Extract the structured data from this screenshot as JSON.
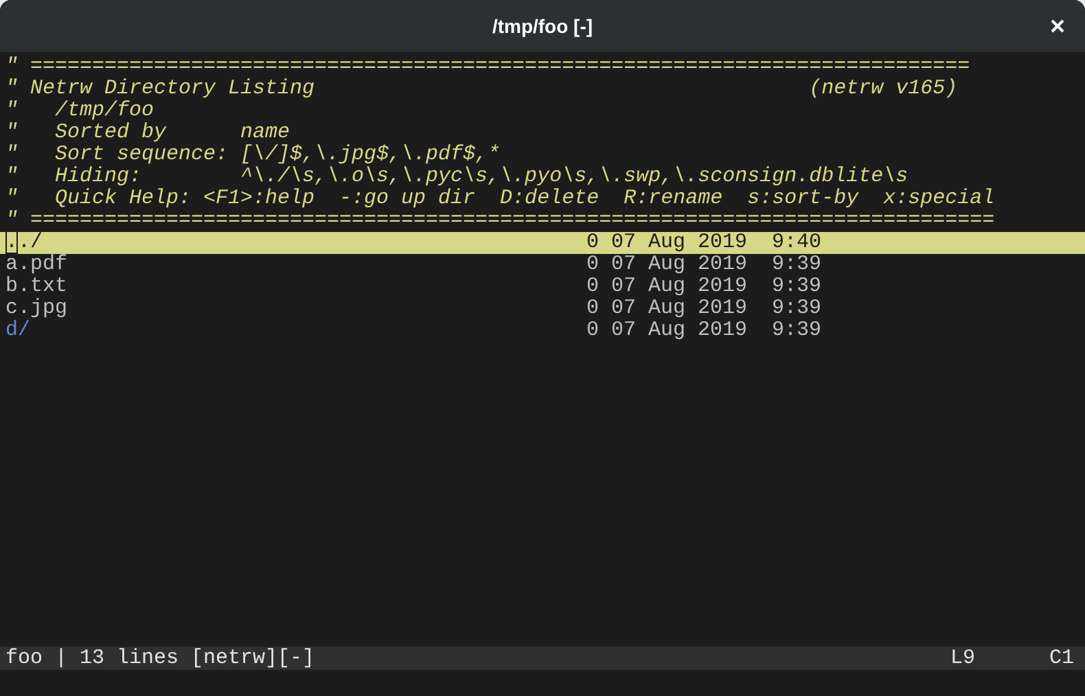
{
  "window": {
    "title": "/tmp/foo [-]"
  },
  "header_lines": [
    "\" ============================================================================",
    "\" Netrw Directory Listing                                        (netrw v165)",
    "\"   /tmp/foo",
    "\"   Sorted by      name",
    "\"   Sort sequence: [\\/]$,\\.jpg$,\\.pdf$,*",
    "\"   Hiding:        ^\\./\\s,\\.o\\s,\\.pyc\\s,\\.pyo\\s,\\.swp,\\.sconsign.dblite\\s",
    "\"   Quick Help: <F1>:help  -:go up dir  D:delete  R:rename  s:sort-by  x:special",
    "\" =============================================================================="
  ],
  "entries": [
    {
      "name": "../",
      "info": "0 07 Aug 2019  9:40",
      "kind": "dir",
      "selected": true
    },
    {
      "name": "a.pdf",
      "info": "0 07 Aug 2019  9:39",
      "kind": "file",
      "selected": false
    },
    {
      "name": "b.txt",
      "info": "0 07 Aug 2019  9:39",
      "kind": "file",
      "selected": false
    },
    {
      "name": "c.jpg",
      "info": "0 07 Aug 2019  9:39",
      "kind": "file",
      "selected": false
    },
    {
      "name": "d/",
      "info": "0 07 Aug 2019  9:39",
      "kind": "dir",
      "selected": false
    }
  ],
  "status_bar": {
    "file_info": "foo | 13 lines [netrw][-]",
    "line": "L9",
    "column": "C1"
  }
}
